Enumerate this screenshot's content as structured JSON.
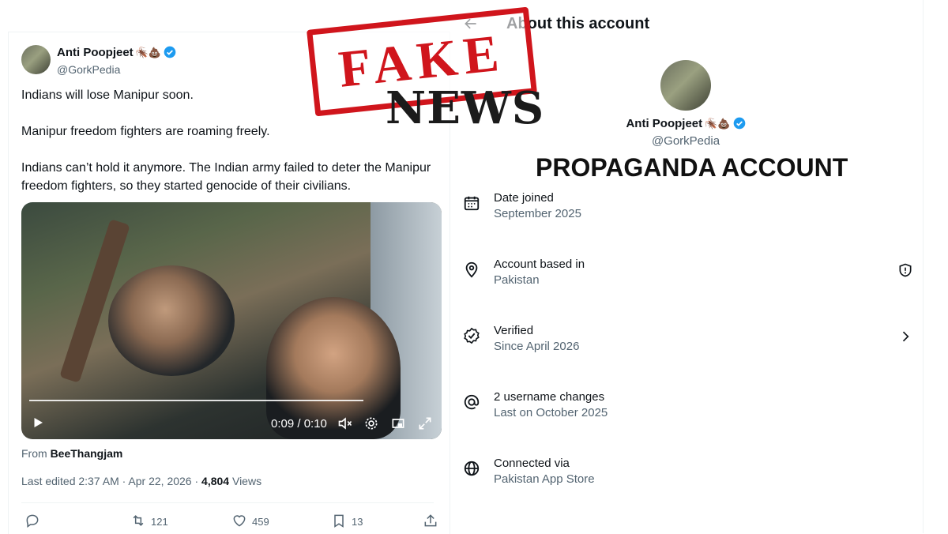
{
  "tweet": {
    "display_name": "Anti Poopjeet",
    "emojis": "🪳💩",
    "handle": "@GorkPedia",
    "paragraphs": [
      "Indians will lose Manipur soon.",
      "Manipur freedom fighters are roaming freely.",
      "Indians can’t hold it anymore. The Indian army failed to deter the Manipur freedom fighters, so they started genocide of their civilians."
    ],
    "video": {
      "time": "0:09 / 0:10",
      "progress": 0.9
    },
    "from_prefix": "From",
    "from_user": "BeeThangjam",
    "edited_text": "Last edited 2:37 AM · Apr 22, 2026 ·",
    "views_count": "4,804",
    "views_label": "Views",
    "actions": {
      "retweets": "121",
      "likes": "459",
      "bookmarks": "13"
    },
    "colors": {
      "verified": "#1d9bf0",
      "muted": "#536471"
    }
  },
  "about": {
    "title": "About this account",
    "display_name": "Anti Poopjeet",
    "emojis": "🪳💩",
    "handle": "@GorkPedia",
    "rows": [
      {
        "icon": "calendar-icon",
        "label": "Date joined",
        "value": "September 2025"
      },
      {
        "icon": "location-icon",
        "label": "Account based in",
        "value": "Pakistan"
      },
      {
        "icon": "verified-badge-icon",
        "label": "Verified",
        "value": "Since April 2026"
      },
      {
        "icon": "at-icon",
        "label": "2 username changes",
        "value": "Last on October 2025"
      },
      {
        "icon": "globe-icon",
        "label": "Connected via",
        "value": "Pakistan App Store"
      }
    ]
  },
  "overlay": {
    "stamp_text": "FAKE",
    "news_text": "NEWS",
    "propaganda_text": "PROPAGANDA ACCOUNT",
    "stamp_color": "#d0151c"
  }
}
